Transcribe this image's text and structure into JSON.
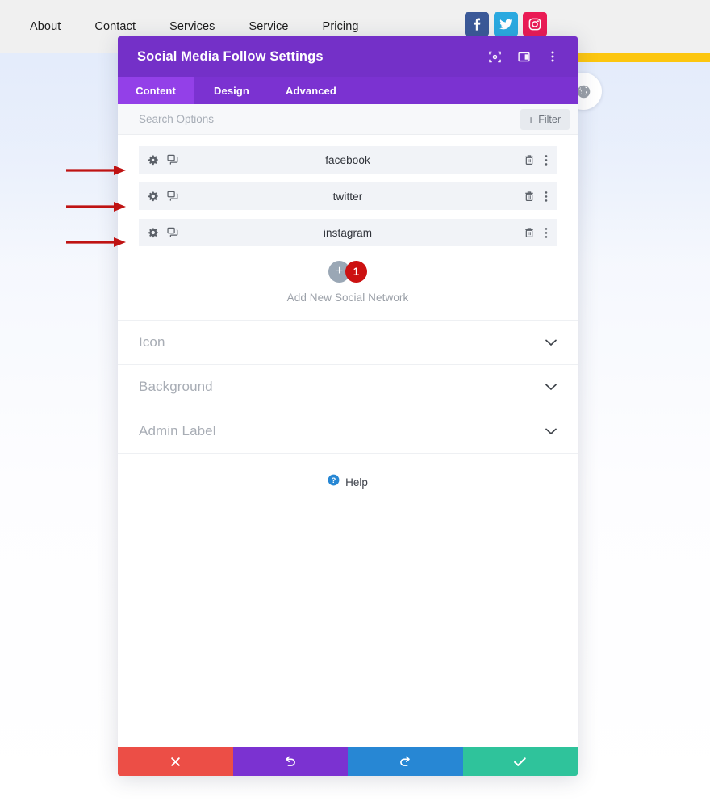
{
  "page": {
    "nav_links": [
      "About",
      "Contact",
      "Services",
      "Service",
      "Pricing"
    ],
    "social_buttons": [
      {
        "name": "facebook",
        "icon": "facebook-icon",
        "color": "#3b5998"
      },
      {
        "name": "twitter",
        "icon": "twitter-icon",
        "color": "#2aa9e0"
      },
      {
        "name": "instagram",
        "icon": "instagram-icon",
        "color": "#ea1b55"
      }
    ],
    "banner_color": "#fcc60f",
    "globe_icon": "globe-icon"
  },
  "modal": {
    "title": "Social Media Follow Settings",
    "titlebar_color": "#7430c8",
    "title_icons": [
      "fullscreen-icon",
      "layout-panel-icon",
      "more-vertical-icon"
    ],
    "tabs": [
      {
        "label": "Content",
        "active": true
      },
      {
        "label": "Design",
        "active": false
      },
      {
        "label": "Advanced",
        "active": false
      }
    ],
    "search": {
      "placeholder": "Search Options",
      "value": ""
    },
    "filter": {
      "plus": "+",
      "label": "Filter"
    },
    "social_rows": [
      {
        "name": "facebook",
        "settings_icon": "gear-icon",
        "duplicate_icon": "duplicate-icon",
        "delete_icon": "trash-icon",
        "menu_icon": "more-vertical-icon"
      },
      {
        "name": "twitter",
        "settings_icon": "gear-icon",
        "duplicate_icon": "duplicate-icon",
        "delete_icon": "trash-icon",
        "menu_icon": "more-vertical-icon"
      },
      {
        "name": "instagram",
        "settings_icon": "gear-icon",
        "duplicate_icon": "duplicate-icon",
        "delete_icon": "trash-icon",
        "menu_icon": "more-vertical-icon"
      }
    ],
    "add_new": {
      "plus": "+",
      "badge_count": "1",
      "badge_color": "#cc1111",
      "label": "Add New Social Network"
    },
    "sections": [
      {
        "title": "Icon",
        "chevron": "chevron-down-icon"
      },
      {
        "title": "Background",
        "chevron": "chevron-down-icon"
      },
      {
        "title": "Admin Label",
        "chevron": "chevron-down-icon"
      }
    ],
    "help": {
      "icon": "question-circle-icon",
      "label": "Help"
    },
    "footer": [
      {
        "action": "cancel",
        "icon": "close-x-icon",
        "color": "#ec4e46"
      },
      {
        "action": "undo",
        "icon": "undo-arrow-icon",
        "color": "#7b32d1"
      },
      {
        "action": "redo",
        "icon": "redo-arrow-icon",
        "color": "#2787d4"
      },
      {
        "action": "save",
        "icon": "checkmark-icon",
        "color": "#2fc39b"
      }
    ]
  },
  "annotations": {
    "arrow_color": "#bf1313",
    "arrows": [
      {
        "target": "facebook-row"
      },
      {
        "target": "twitter-row"
      },
      {
        "target": "instagram-row"
      }
    ]
  }
}
